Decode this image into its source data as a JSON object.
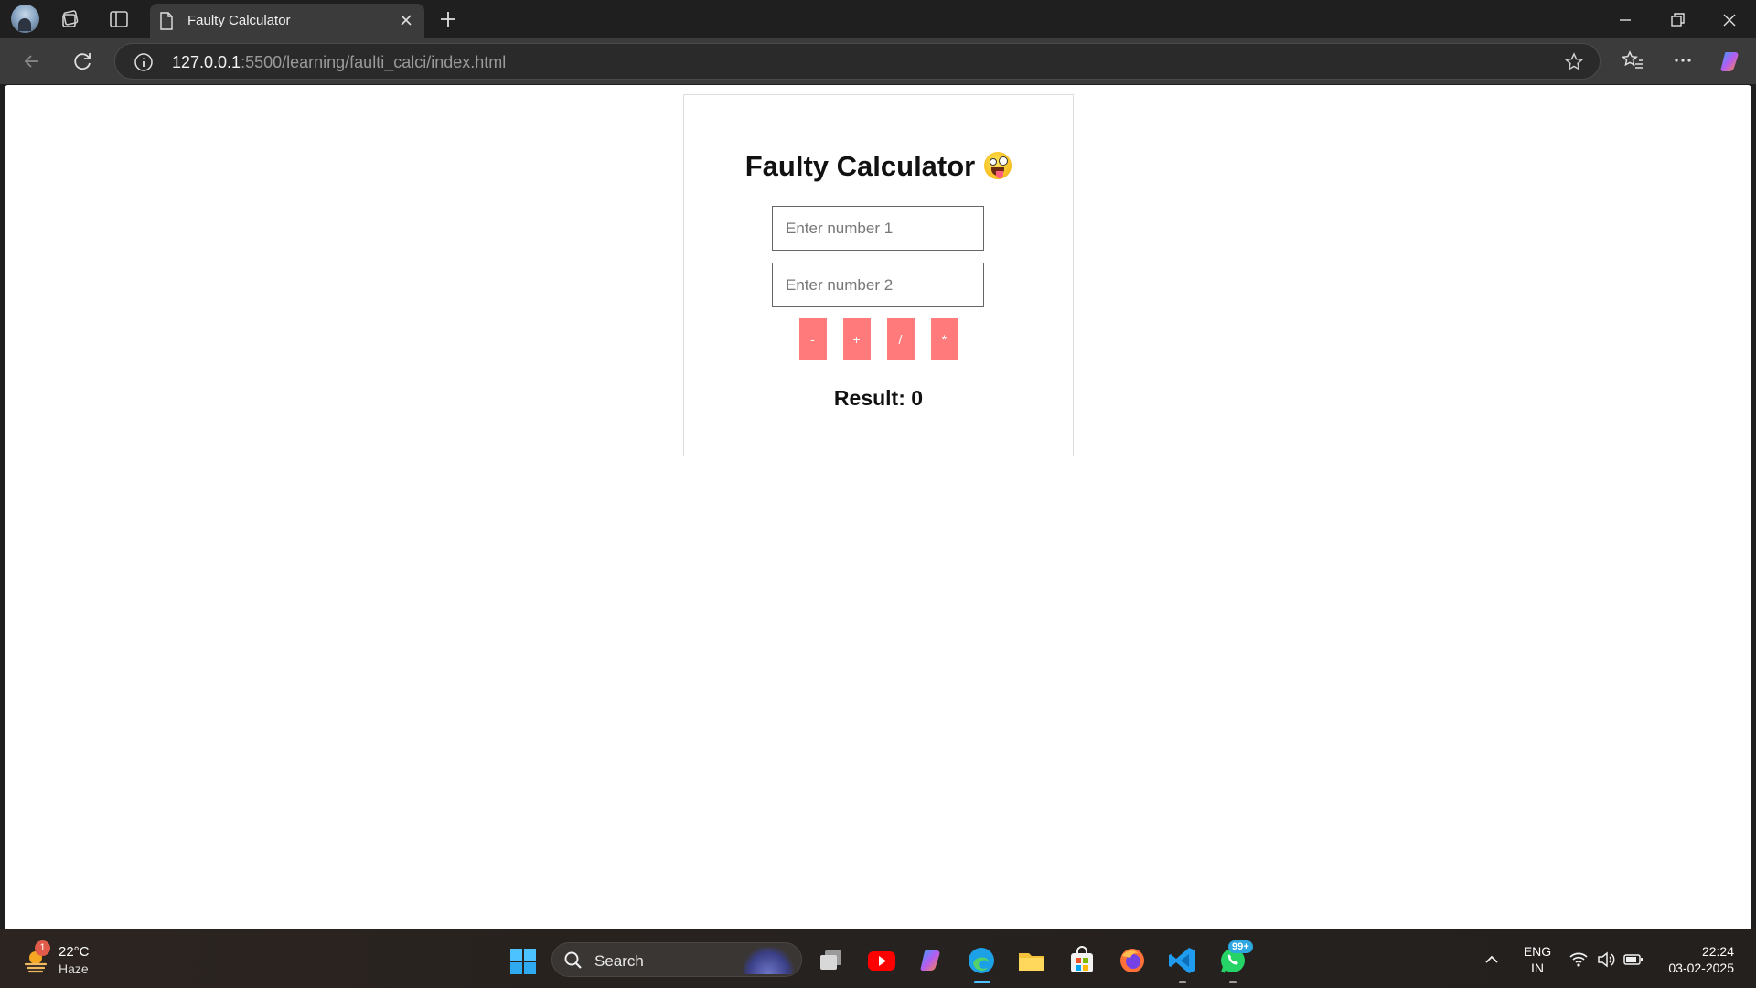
{
  "browser": {
    "tab_title": "Faulty Calculator",
    "url_host": "127.0.0.1",
    "url_path": ":5500/learning/faulti_calci/index.html"
  },
  "page": {
    "title": "Faulty Calculator",
    "input1_placeholder": "Enter number 1",
    "input2_placeholder": "Enter number 2",
    "operators": [
      "-",
      "+",
      "/",
      "*"
    ],
    "result_label": "Result: 0",
    "button_color": "#ff7b7b"
  },
  "taskbar": {
    "weather_temp": "22°C",
    "weather_desc": "Haze",
    "weather_badge": "1",
    "search_label": "Search",
    "lang_top": "ENG",
    "lang_bottom": "IN",
    "time": "22:24",
    "date": "03-02-2025",
    "whatsapp_badge": "99+"
  }
}
